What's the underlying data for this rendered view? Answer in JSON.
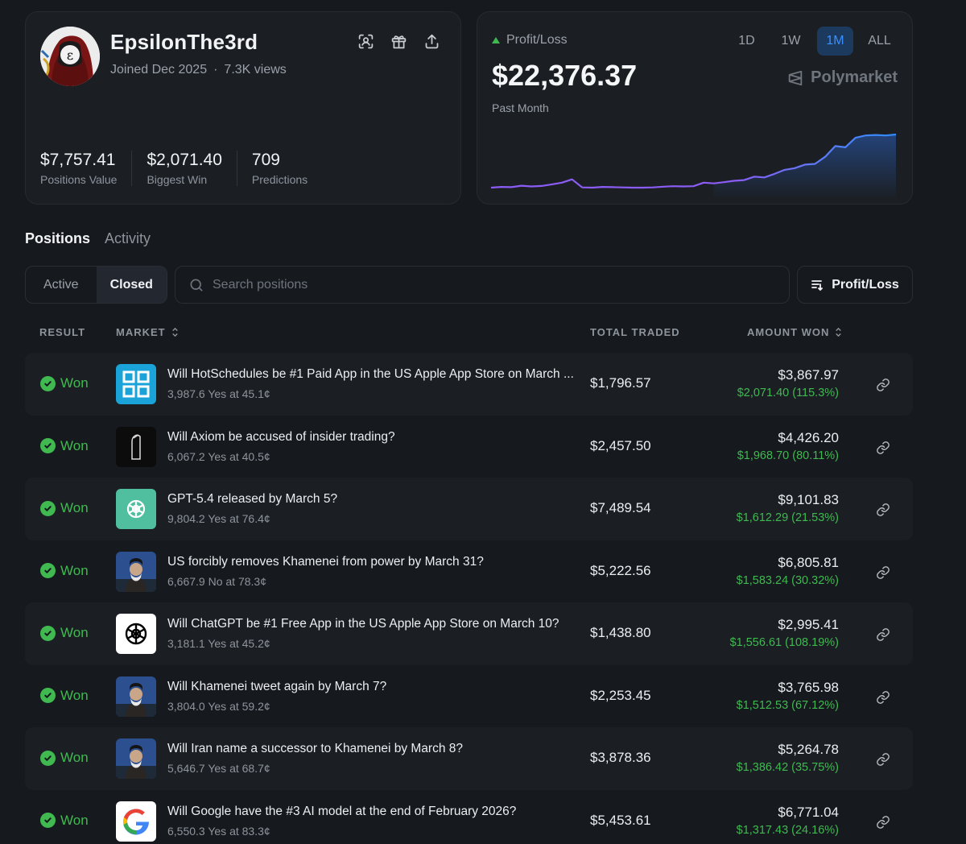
{
  "profile": {
    "username": "EpsilonThe3rd",
    "joined": "Joined Dec 2025",
    "views": "7.3K views",
    "separator": "·",
    "stats": [
      {
        "value": "$7,757.41",
        "label": "Positions Value"
      },
      {
        "value": "$2,071.40",
        "label": "Biggest Win"
      },
      {
        "value": "709",
        "label": "Predictions"
      }
    ],
    "icons": [
      "scan-profile-icon",
      "gift-icon",
      "share-icon"
    ]
  },
  "pnl": {
    "label": "Profit/Loss",
    "value": "$22,376.37",
    "period": "Past Month",
    "brand": "Polymarket",
    "ranges": [
      "1D",
      "1W",
      "1M",
      "ALL"
    ],
    "active_range": "1M",
    "colors": {
      "line_start": "#8b5cf6",
      "line_end": "#2f8cff",
      "up": "#3fb950"
    }
  },
  "chart_data": {
    "type": "line",
    "series": [
      {
        "values": [
          0.0,
          0.3,
          0.2,
          0.8,
          0.5,
          0.7,
          1.4,
          2.1,
          3.5,
          0.1,
          0.0,
          0.3,
          0.2,
          0.1,
          0.0,
          0.0,
          0.1,
          0.4,
          0.6,
          0.5,
          0.6,
          2.1,
          1.8,
          2.3,
          2.9,
          3.2,
          4.6,
          4.3,
          5.8,
          7.5,
          8.2,
          9.7,
          10.0,
          13.0,
          17.5,
          17.0,
          21.0,
          22.0,
          22.2,
          22.0,
          22.4
        ]
      }
    ]
  },
  "nav": {
    "tabs": [
      "Positions",
      "Activity"
    ],
    "filters": [
      "Active",
      "Closed"
    ],
    "search_placeholder": "Search positions",
    "sort_label": "Profit/Loss"
  },
  "table": {
    "headers": {
      "result": "RESULT",
      "market": "MARKET",
      "total_traded": "TOTAL TRADED",
      "amount_won": "AMOUNT WON"
    },
    "rows": [
      {
        "result": "Won",
        "title": "Will HotSchedules be #1 Paid App in the US Apple App Store on March ...",
        "detail": "3,987.6 Yes at 45.1¢",
        "traded": "$1,796.57",
        "won": "$3,867.97",
        "profit": "$2,071.40 (115.3%)",
        "thumb": "hotschedules-logo"
      },
      {
        "result": "Won",
        "title": "Will Axiom be accused of insider trading?",
        "detail": "6,067.2 Yes at 40.5¢",
        "traded": "$2,457.50",
        "won": "$4,426.20",
        "profit": "$1,968.70 (80.11%)",
        "thumb": "axiom-logo"
      },
      {
        "result": "Won",
        "title": "GPT-5.4 released by March 5?",
        "detail": "9,804.2 Yes at 76.4¢",
        "traded": "$7,489.54",
        "won": "$9,101.83",
        "profit": "$1,612.29 (21.53%)",
        "thumb": "openai-green-logo"
      },
      {
        "result": "Won",
        "title": "US forcibly removes Khamenei from power by March 31?",
        "detail": "6,667.9 No at 78.3¢",
        "traded": "$5,222.56",
        "won": "$6,805.81",
        "profit": "$1,583.24 (30.32%)",
        "thumb": "khamenei-photo"
      },
      {
        "result": "Won",
        "title": "Will ChatGPT be #1 Free App in the US Apple App Store on March 10?",
        "detail": "3,181.1 Yes at 45.2¢",
        "traded": "$1,438.80",
        "won": "$2,995.41",
        "profit": "$1,556.61 (108.19%)",
        "thumb": "openai-white-logo"
      },
      {
        "result": "Won",
        "title": "Will Khamenei tweet again by March 7?",
        "detail": "3,804.0 Yes at 59.2¢",
        "traded": "$2,253.45",
        "won": "$3,765.98",
        "profit": "$1,512.53 (67.12%)",
        "thumb": "khamenei-photo"
      },
      {
        "result": "Won",
        "title": "Will Iran name a successor to Khamenei by March 8?",
        "detail": "5,646.7 Yes at 68.7¢",
        "traded": "$3,878.36",
        "won": "$5,264.78",
        "profit": "$1,386.42 (35.75%)",
        "thumb": "khamenei-photo"
      },
      {
        "result": "Won",
        "title": "Will Google have the #3 AI model at the end of February 2026?",
        "detail": "6,550.3 Yes at 83.3¢",
        "traded": "$5,453.61",
        "won": "$6,771.04",
        "profit": "$1,317.43 (24.16%)",
        "thumb": "google-logo"
      }
    ]
  }
}
